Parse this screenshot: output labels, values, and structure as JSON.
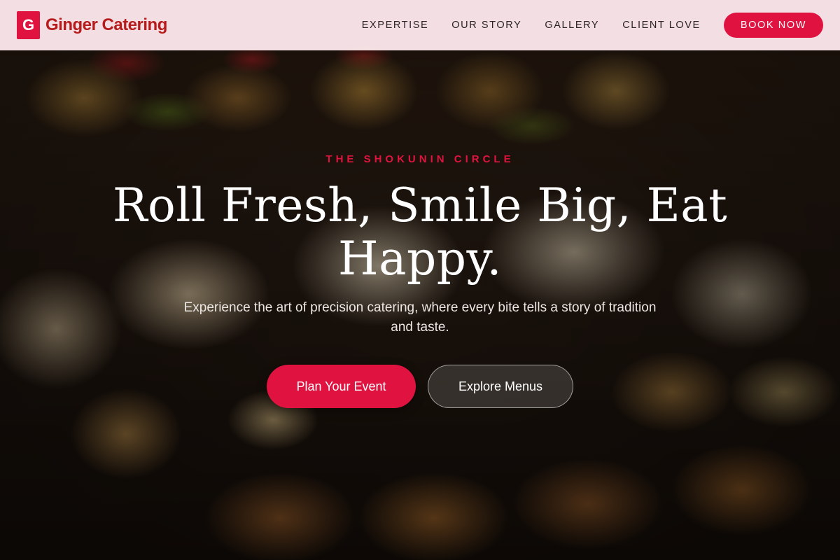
{
  "brand": {
    "logo_letter": "G",
    "name": "Ginger Catering"
  },
  "nav": {
    "items": [
      {
        "label": "EXPERTISE"
      },
      {
        "label": "OUR STORY"
      },
      {
        "label": "GALLERY"
      },
      {
        "label": "CLIENT LOVE"
      }
    ],
    "book_label": "BOOK NOW"
  },
  "hero": {
    "eyebrow": "THE SHOKUNIN CIRCLE",
    "headline": "Roll Fresh, Smile Big, Eat Happy.",
    "subtext": "Experience the art of precision catering, where every bite tells a story of tradition and taste.",
    "primary_cta": "Plan Your Event",
    "secondary_cta": "Explore Menus"
  },
  "colors": {
    "accent": "#e0123f",
    "brand_text": "#b71c1c",
    "header_bg": "#fce8ec"
  }
}
